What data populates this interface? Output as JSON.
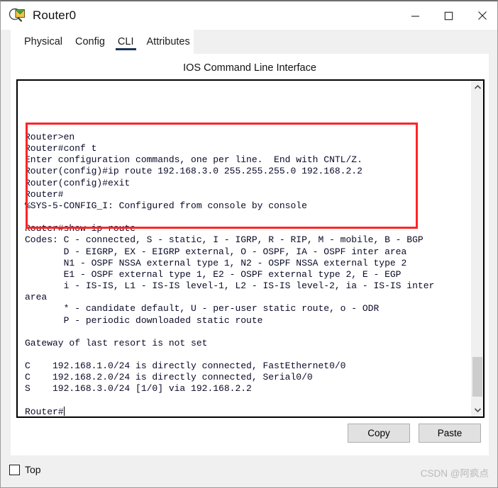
{
  "window": {
    "title": "Router0",
    "icon": "packet-tracer-router-icon",
    "controls": {
      "minimize": "—",
      "maximize": "☐",
      "close": "✕"
    }
  },
  "tabs": [
    {
      "label": "Physical",
      "active": false
    },
    {
      "label": "Config",
      "active": false
    },
    {
      "label": "CLI",
      "active": true
    },
    {
      "label": "Attributes",
      "active": false
    }
  ],
  "panel": {
    "title": "IOS Command Line Interface"
  },
  "terminal": {
    "text": "Router>en\nRouter#conf t\nEnter configuration commands, one per line.  End with CNTL/Z.\nRouter(config)#ip route 192.168.3.0 255.255.255.0 192.168.2.2\nRouter(config)#exit\nRouter#\n%SYS-5-CONFIG_I: Configured from console by console\n\nRouter#show ip route\nCodes: C - connected, S - static, I - IGRP, R - RIP, M - mobile, B - BGP\n       D - EIGRP, EX - EIGRP external, O - OSPF, IA - OSPF inter area\n       N1 - OSPF NSSA external type 1, N2 - OSPF NSSA external type 2\n       E1 - OSPF external type 1, E2 - OSPF external type 2, E - EGP\n       i - IS-IS, L1 - IS-IS level-1, L2 - IS-IS level-2, ia - IS-IS inter\narea\n       * - candidate default, U - per-user static route, o - ODR\n       P - periodic downloaded static route\n\nGateway of last resort is not set\n\nC    192.168.1.0/24 is directly connected, FastEthernet0/0\nC    192.168.2.0/24 is directly connected, Serial0/0\nS    192.168.3.0/24 [1/0] via 192.168.2.2\n\nRouter#",
    "highlight_color": "#ff2424",
    "scroll_up_icon": "⌃",
    "scroll_down_icon": "⌄"
  },
  "buttons": {
    "copy": "Copy",
    "paste": "Paste"
  },
  "footer": {
    "top_checkbox_label": "Top",
    "top_checked": false,
    "watermark": "CSDN @阿疯点"
  }
}
